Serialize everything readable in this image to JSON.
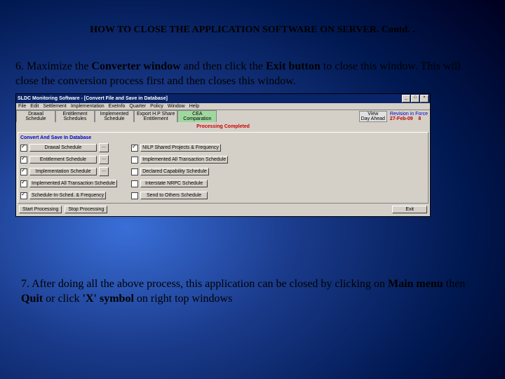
{
  "slide": {
    "title": "HOW TO CLOSE THE APPLICATION SOFTWARE ON SERVER.  Contd. .",
    "step6_prefix": "6. Maximize the ",
    "step6_bold1": "Converter window",
    "step6_mid": " and then click the ",
    "step6_bold2": "Exit button",
    "step6_suffix": " to close this window. This will close the conversion process first and then closes this window.",
    "step7_prefix": "7. After doing all the above process, this application can be closed by clicking on ",
    "step7_bold1": "Main menu",
    "step7_mid1": " then ",
    "step7_bold2": "Quit",
    "step7_mid2": " or click ",
    "step7_bold3": "'X' symbol",
    "step7_suffix": " on right top windows"
  },
  "window": {
    "title": "SLDC Monitoring Software - [Convert File and Save in Database]",
    "tb_min": "_",
    "tb_max": "□",
    "tb_close": "×"
  },
  "menu": [
    "File",
    "Edit",
    "Settlement",
    "Implementation",
    "ExeInfo",
    "Quarter",
    "Policy",
    "Window",
    "Help"
  ],
  "tabs": {
    "t1": "Drawal\nSchedule",
    "t2": "Entitlement\nSchedules",
    "t3": "Implemented\nSchedule",
    "t4": "Export H.P Share\nEntitlement",
    "t5": "CEA\nComparation"
  },
  "status": {
    "view_btn": "View\nDay Ahead",
    "rev_label": "Revision in Force",
    "rev_date": "27-Feb-09",
    "rev_num": "8",
    "processing": "Processing Completed"
  },
  "panel": {
    "header": "Convert And Save In Database",
    "left": [
      "Drawal Schedule",
      "Entitlement Schedule",
      "Implementation Schedule",
      "Implemented All Transaction Schedule",
      "Schedule-In-Sched. & Frequency"
    ],
    "right": [
      "NILP Shared Projects & Frequency",
      "Implemented All Transaction Schedule",
      "Declared Capability Schedule",
      "Interstate NRPC Schedule",
      "Send to Others Schedule"
    ]
  },
  "buttons": {
    "start": "Start Processing",
    "stop": "Stop Processing",
    "exit": "Exit"
  }
}
